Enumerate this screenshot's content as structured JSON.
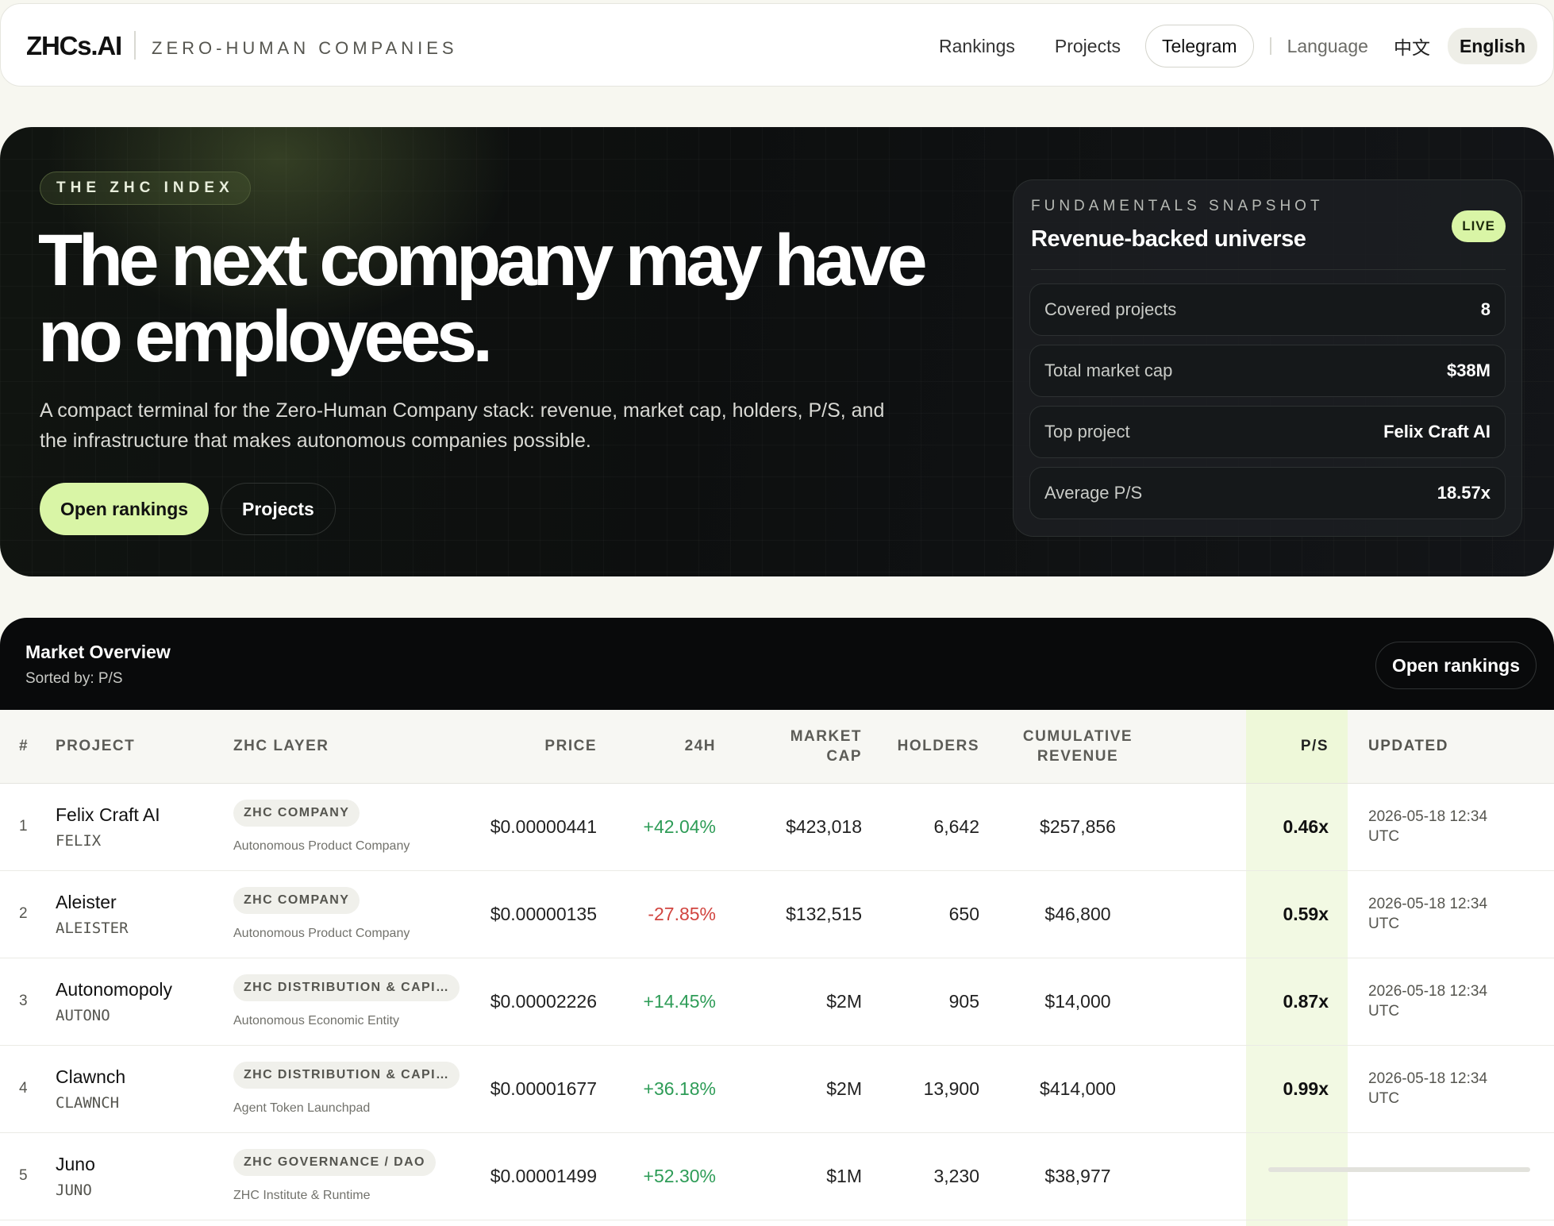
{
  "header": {
    "logo": "ZHCs.AI",
    "tagline": "ZERO-HUMAN COMPANIES",
    "nav": {
      "rankings": "Rankings",
      "projects": "Projects",
      "telegram": "Telegram",
      "language_label": "Language",
      "lang_zh": "中文",
      "lang_en": "English"
    }
  },
  "hero": {
    "badge": "THE ZHC INDEX",
    "title": "The next company may have no employees.",
    "subtitle": "A compact terminal for the Zero-Human Company stack: revenue, market cap, holders, P/S, and the infrastructure that makes autonomous companies possible.",
    "primary_button": "Open rankings",
    "secondary_button": "Projects",
    "snapshot": {
      "label": "FUNDAMENTALS SNAPSHOT",
      "title": "Revenue-backed universe",
      "live": "LIVE",
      "rows": [
        {
          "label": "Covered projects",
          "value": "8"
        },
        {
          "label": "Total market cap",
          "value": "$38M"
        },
        {
          "label": "Top project",
          "value": "Felix Craft AI"
        },
        {
          "label": "Average P/S",
          "value": "18.57x"
        }
      ]
    }
  },
  "market": {
    "title": "Market Overview",
    "sorted_by": "Sorted by: P/S",
    "button": "Open rankings",
    "columns": {
      "rank": "#",
      "project": "PROJECT",
      "layer": "ZHC LAYER",
      "price": "PRICE",
      "change": "24H",
      "market_cap_1": "MARKET",
      "market_cap_2": "CAP",
      "holders": "HOLDERS",
      "revenue_1": "CUMULATIVE",
      "revenue_2": "REVENUE",
      "ps": "P/S",
      "updated": "UPDATED"
    },
    "rows": [
      {
        "rank": "1",
        "name": "Felix Craft AI",
        "ticker": "FELIX",
        "layer": "ZHC COMPANY",
        "layer_sub": "Autonomous Product Company",
        "price": "$0.00000441",
        "change": "+42.04%",
        "market_cap": "$423,018",
        "holders": "6,642",
        "revenue": "$257,856",
        "ps": "0.46x",
        "updated_1": "2026-05-18 12:34",
        "updated_2": "UTC"
      },
      {
        "rank": "2",
        "name": "Aleister",
        "ticker": "ALEISTER",
        "layer": "ZHC COMPANY",
        "layer_sub": "Autonomous Product Company",
        "price": "$0.00000135",
        "change": "-27.85%",
        "market_cap": "$132,515",
        "holders": "650",
        "revenue": "$46,800",
        "ps": "0.59x",
        "updated_1": "2026-05-18 12:34",
        "updated_2": "UTC"
      },
      {
        "rank": "3",
        "name": "Autonomopoly",
        "ticker": "AUTONO",
        "layer": "ZHC DISTRIBUTION & CAPIT…",
        "layer_sub": "Autonomous Economic Entity",
        "price": "$0.00002226",
        "change": "+14.45%",
        "market_cap": "$2M",
        "holders": "905",
        "revenue": "$14,000",
        "ps": "0.87x",
        "updated_1": "2026-05-18 12:34",
        "updated_2": "UTC"
      },
      {
        "rank": "4",
        "name": "Clawnch",
        "ticker": "CLAWNCH",
        "layer": "ZHC DISTRIBUTION & CAPIT…",
        "layer_sub": "Agent Token Launchpad",
        "price": "$0.00001677",
        "change": "+36.18%",
        "market_cap": "$2M",
        "holders": "13,900",
        "revenue": "$414,000",
        "ps": "0.99x",
        "updated_1": "2026-05-18 12:34",
        "updated_2": "UTC"
      },
      {
        "rank": "5",
        "name": "Juno",
        "ticker": "JUNO",
        "layer": "ZHC GOVERNANCE / DAO",
        "layer_sub": "ZHC Institute & Runtime",
        "price": "$0.00001499",
        "change": "+52.30%",
        "market_cap": "$1M",
        "holders": "3,230",
        "revenue": "$38,977",
        "ps": "",
        "updated_1": "",
        "updated_2": ""
      }
    ]
  },
  "colors": {
    "accent": "#d9f5a6",
    "positive": "#2e9c57",
    "negative": "#d1443f",
    "hero_bg": "#0d0f0f",
    "page_bg": "#f7f7f0"
  }
}
